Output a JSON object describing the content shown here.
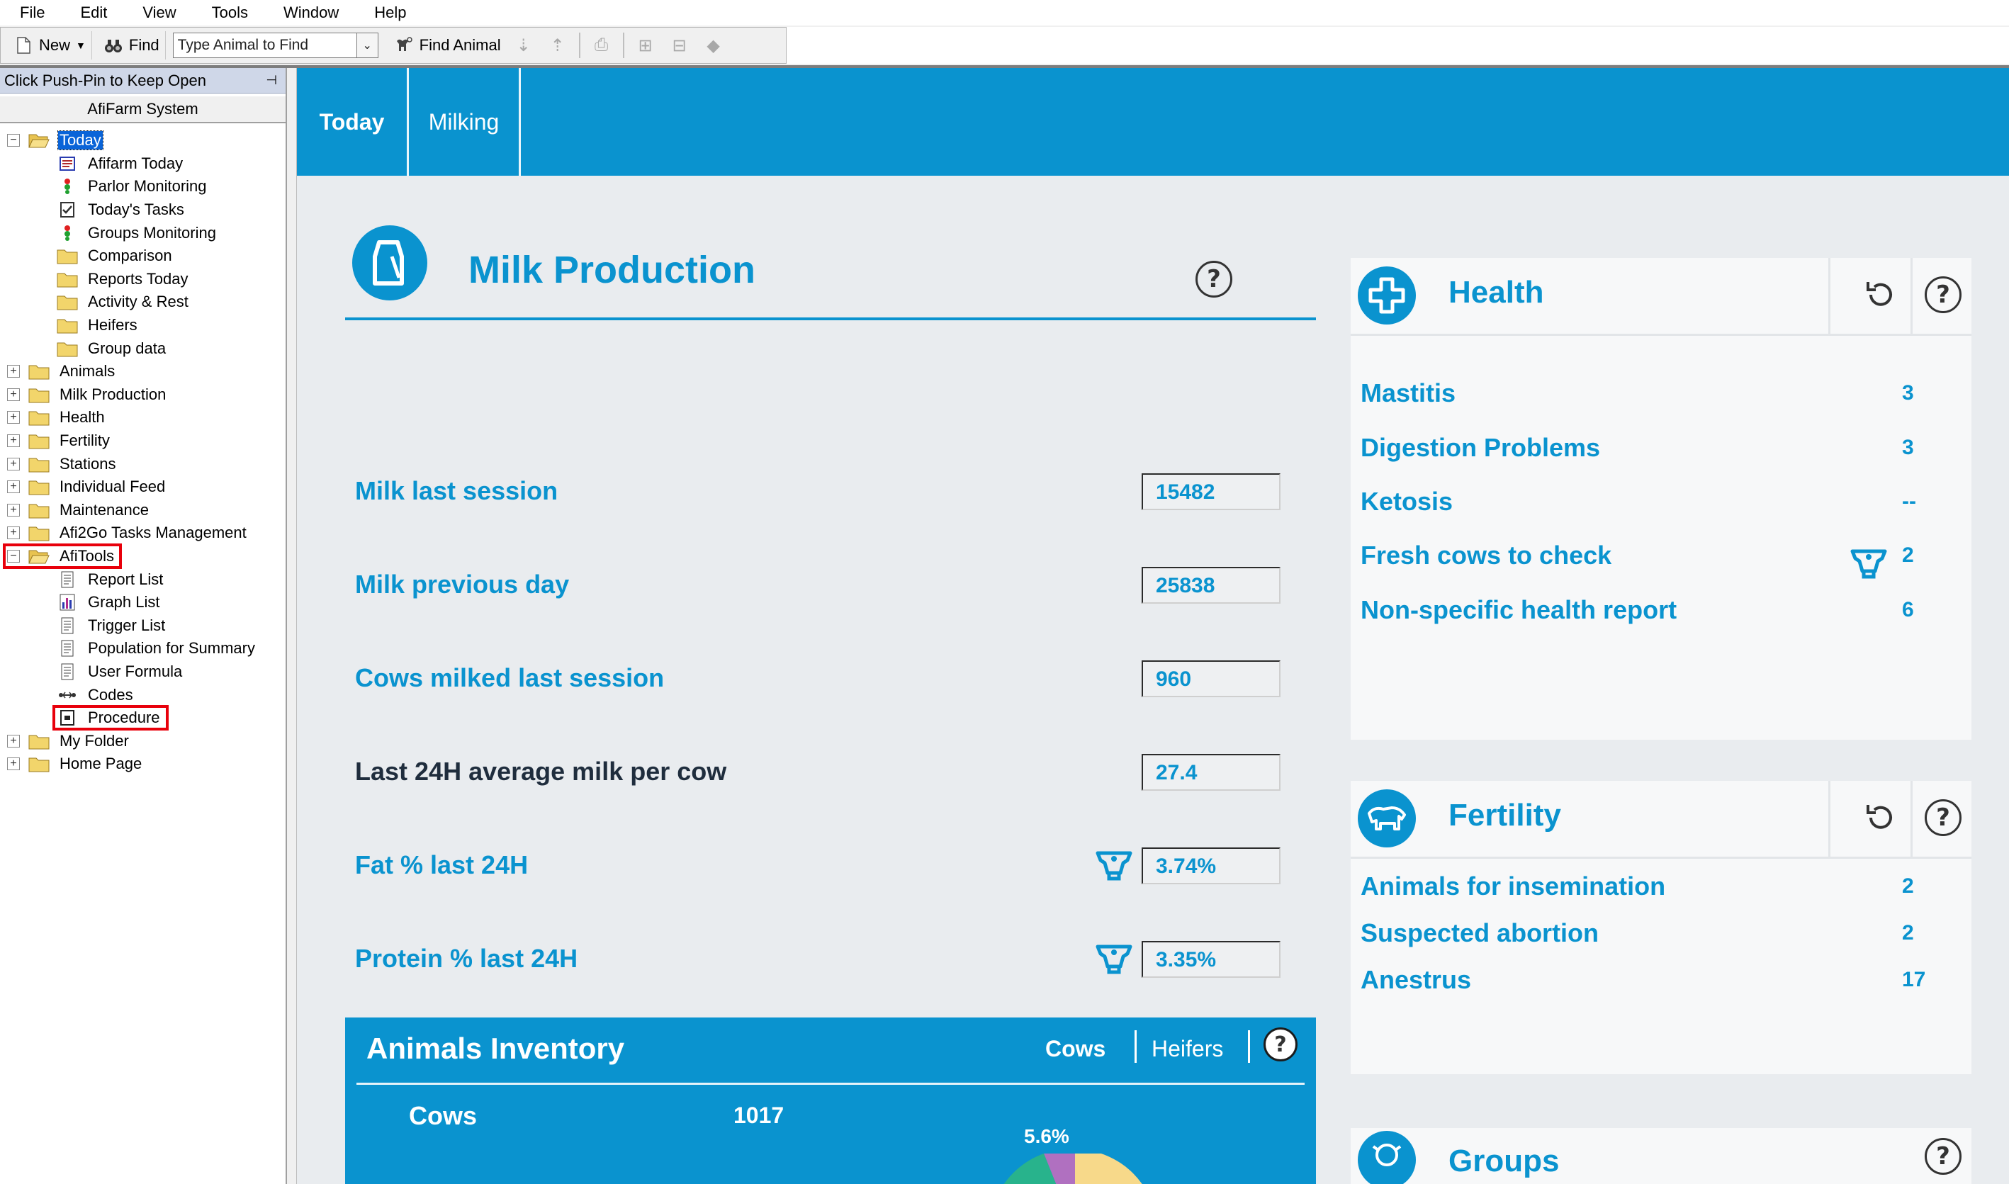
{
  "menu": [
    "File",
    "Edit",
    "View",
    "Tools",
    "Window",
    "Help"
  ],
  "toolbar": {
    "new_label": "New",
    "find_label": "Find",
    "find_placeholder": "Type Animal to Find",
    "find_animal_label": "Find Animal"
  },
  "left_panel": {
    "pin_text": "Click Push-Pin to Keep Open",
    "system_title": "AfiFarm System",
    "tree": {
      "today": "Today",
      "today_children": [
        "Afifarm Today",
        "Parlor Monitoring",
        "Today's Tasks",
        "Groups Monitoring",
        "Comparison",
        "Reports Today",
        "Activity & Rest",
        "Heifers",
        "Group data"
      ],
      "top_folders": [
        "Animals",
        "Milk Production",
        "Health",
        "Fertility",
        "Stations",
        "Individual Feed",
        "Maintenance",
        "Afi2Go Tasks Management"
      ],
      "afitools": "AfiTools",
      "afitools_children": [
        "Report List",
        "Graph List",
        "Trigger List",
        "Population for Summary",
        "User Formula",
        "Codes",
        "Procedure"
      ],
      "bottom_folders": [
        "My Folder",
        "Home Page"
      ]
    }
  },
  "tabs": [
    "Today",
    "Milking"
  ],
  "milk_production": {
    "title": "Milk Production",
    "rows": [
      {
        "label": "Milk last session",
        "value": "15482"
      },
      {
        "label": "Milk previous day",
        "value": "25838"
      },
      {
        "label": "Cows milked last session",
        "value": "960"
      },
      {
        "label": "Last 24H average milk per cow",
        "value": "27.4"
      },
      {
        "label": "Fat % last 24H",
        "value": "3.74%"
      },
      {
        "label": "Protein % last 24H",
        "value": "3.35%"
      }
    ]
  },
  "inventory": {
    "title": "Animals Inventory",
    "tab_cows": "Cows",
    "tab_heifers": "Heifers",
    "cows_label": "Cows",
    "cows_value": "1017",
    "pie_pct": "5.6%"
  },
  "health": {
    "title": "Health",
    "rows": [
      {
        "label": "Mastitis",
        "value": "3"
      },
      {
        "label": "Digestion Problems",
        "value": "3"
      },
      {
        "label": "Ketosis",
        "value": "--"
      },
      {
        "label": "Fresh cows to check",
        "value": "2"
      },
      {
        "label": "Non-specific health report",
        "value": "6"
      }
    ]
  },
  "fertility": {
    "title": "Fertility",
    "rows": [
      {
        "label": "Animals for insemination",
        "value": "2"
      },
      {
        "label": "Suspected abortion",
        "value": "2"
      },
      {
        "label": "Anestrus",
        "value": "17"
      }
    ]
  },
  "groups": {
    "title": "Groups"
  },
  "colors": {
    "accent": "#0a93cf",
    "highlight": "#e8000b",
    "selection": "#0a64d8"
  }
}
